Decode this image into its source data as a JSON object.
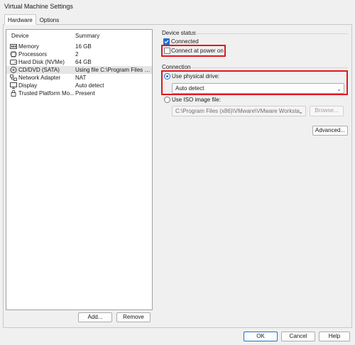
{
  "window": {
    "title": "Virtual Machine Settings"
  },
  "tabs": [
    {
      "label": "Hardware",
      "active": true
    },
    {
      "label": "Options",
      "active": false
    }
  ],
  "device_list": {
    "headers": {
      "device": "Device",
      "summary": "Summary"
    },
    "rows": [
      {
        "icon": "memory-icon",
        "device": "Memory",
        "summary": "16 GB",
        "selected": false
      },
      {
        "icon": "processor-icon",
        "device": "Processors",
        "summary": "2",
        "selected": false
      },
      {
        "icon": "hard-disk-icon",
        "device": "Hard Disk (NVMe)",
        "summary": "64 GB",
        "selected": false
      },
      {
        "icon": "cd-dvd-icon",
        "device": "CD/DVD (SATA)",
        "summary": "Using file C:\\Program Files (...",
        "selected": true
      },
      {
        "icon": "network-adapter-icon",
        "device": "Network Adapter",
        "summary": "NAT",
        "selected": false
      },
      {
        "icon": "display-icon",
        "device": "Display",
        "summary": "Auto detect",
        "selected": false
      },
      {
        "icon": "trusted-platform-icon",
        "device": "Trusted Platform Mo...",
        "summary": "Present",
        "selected": false
      }
    ],
    "add_label": "Add...",
    "remove_label": "Remove"
  },
  "device_status": {
    "group_label": "Device status",
    "connected_label": "Connected",
    "connected_checked": true,
    "power_on_label": "Connect at power on",
    "power_on_checked": false
  },
  "connection": {
    "group_label": "Connection",
    "physical_label": "Use physical drive:",
    "physical_selected": true,
    "physical_value": "Auto detect",
    "iso_label": "Use ISO image file:",
    "iso_selected": false,
    "iso_value": "C:\\Program Files (x86)\\VMware\\VMware Worksta",
    "browse_label": "Browse...",
    "advanced_label": "Advanced..."
  },
  "footer": {
    "ok_label": "OK",
    "cancel_label": "Cancel",
    "help_label": "Help"
  },
  "colors": {
    "accent": "#1f6fd1",
    "highlight_box": "#e0171f",
    "selected_row": "#e5e5e5"
  }
}
